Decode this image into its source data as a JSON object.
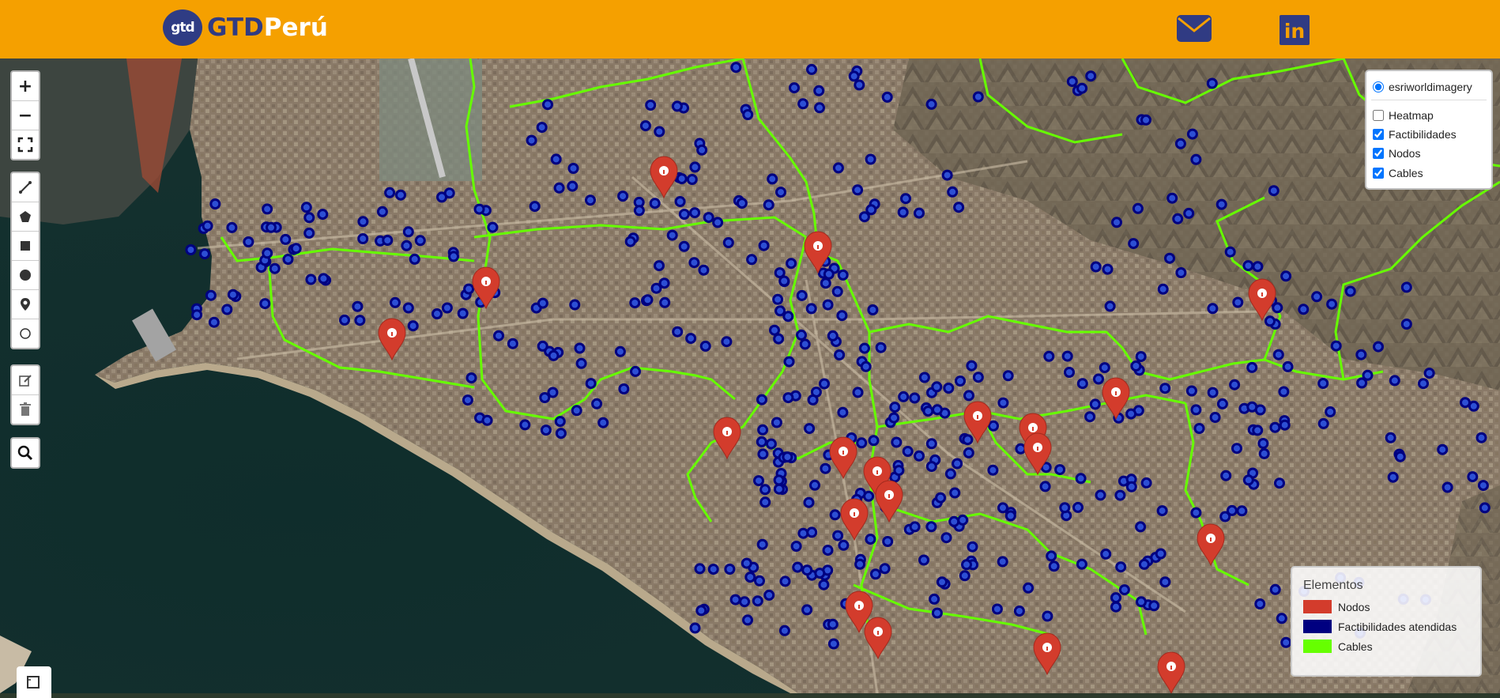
{
  "header": {
    "logo_badge": "gtd",
    "logo_prefix": "GTD",
    "logo_suffix": "Perú",
    "mail_icon": "envelope-icon",
    "linkedin_icon": "linkedin-icon",
    "linkedin_text": "in"
  },
  "colors": {
    "header_bg": "#f5a000",
    "brand_navy": "#303b83",
    "node_red": "#d33c2c",
    "facility_blue": "#000080",
    "cable_green": "#66ff00"
  },
  "map_controls": {
    "zoom_in": "+",
    "zoom_out": "−",
    "fullscreen_icon": "fullscreen-icon",
    "draw_tools": [
      "polyline-icon",
      "polygon-icon",
      "rectangle-icon",
      "circle-icon",
      "marker-icon",
      "circlemarker-icon"
    ],
    "edit_tools": [
      "edit-icon",
      "trash-icon"
    ],
    "search_icon": "search-icon"
  },
  "layers": {
    "base": {
      "label": "esriworldimagery",
      "checked": true
    },
    "overlays": [
      {
        "label": "Heatmap",
        "checked": false
      },
      {
        "label": "Factibilidades",
        "checked": true
      },
      {
        "label": "Nodos",
        "checked": true
      },
      {
        "label": "Cables",
        "checked": true
      }
    ]
  },
  "legend": {
    "title": "Elementos",
    "items": [
      {
        "label": "Nodos",
        "color": "#d33c2c"
      },
      {
        "label": "Factibilidades atendidas",
        "color": "#000080"
      },
      {
        "label": "Cables",
        "color": "#66ff00"
      }
    ]
  },
  "marker_icon": "info-marker-icon"
}
